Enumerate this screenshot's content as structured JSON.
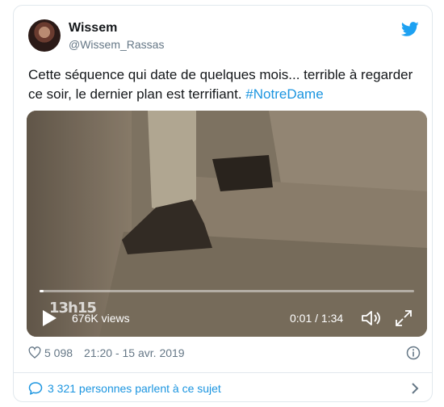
{
  "tweet": {
    "author_name": "Wissem",
    "author_handle": "@Wissem_Rassas",
    "text": "Cette séquence qui date de quelques mois... terrible à regarder ce soir, le dernier plan est terrifiant. ",
    "hashtag": "#NotreDame"
  },
  "video": {
    "logo_text": "13h15",
    "views": "676K views",
    "time": "0:01 / 1:34",
    "progress_fraction": 0.01
  },
  "footer": {
    "likes": "5 098",
    "timestamp": "21:20 - 15 avr. 2019",
    "conversation": "3 321 personnes parlent à ce sujet"
  },
  "icons": {
    "brand": "twitter-bird-icon",
    "play": "play-icon",
    "volume": "volume-muted-icon",
    "fullscreen": "fullscreen-icon",
    "like": "heart-icon",
    "info": "info-icon",
    "conversation": "speech-bubble-icon",
    "more": "chevron-right-icon"
  },
  "colors": {
    "brand_blue": "#1da1f2",
    "link_blue": "#1b95e0",
    "secondary_text": "#657786"
  }
}
